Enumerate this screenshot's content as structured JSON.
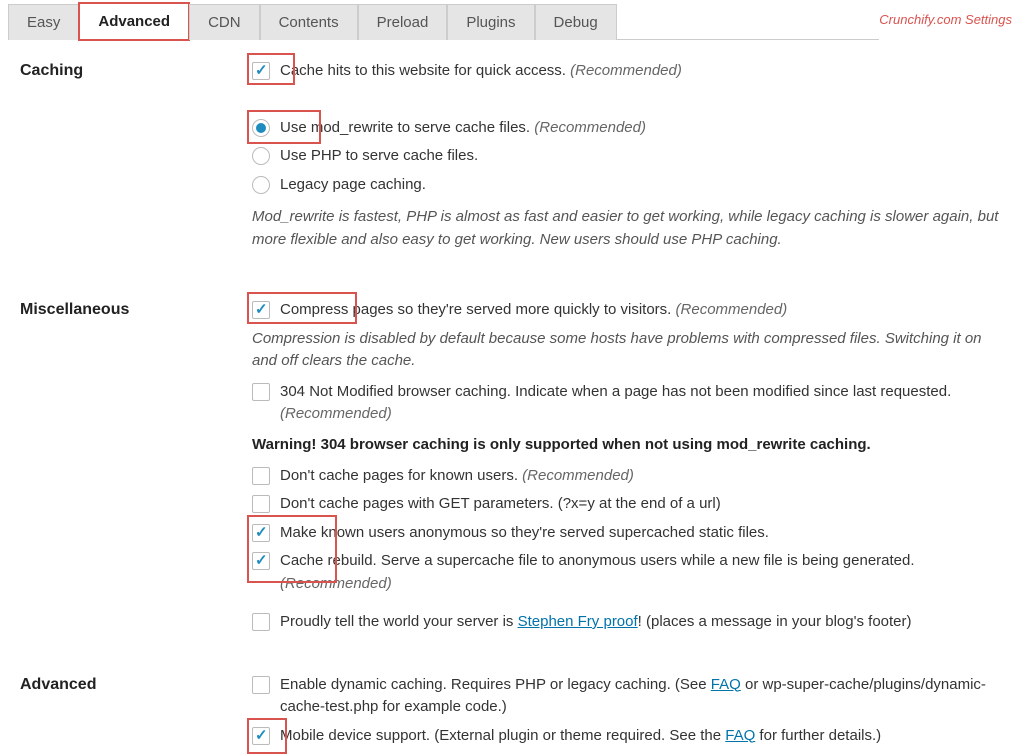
{
  "watermark": "Crunchify.com Settings",
  "tabs": [
    "Easy",
    "Advanced",
    "CDN",
    "Contents",
    "Preload",
    "Plugins",
    "Debug"
  ],
  "active_tab_index": 1,
  "sections": {
    "caching": {
      "title": "Caching",
      "cache_hits": {
        "label": "Cache hits to this website for quick access.",
        "reco": "(Recommended)",
        "checked": true
      },
      "serve": {
        "mod_rewrite": {
          "label": "Use mod_rewrite to serve cache files.",
          "reco": "(Recommended)"
        },
        "php": {
          "label": "Use PHP to serve cache files."
        },
        "legacy": {
          "label": "Legacy page caching."
        }
      },
      "desc": "Mod_rewrite is fastest, PHP is almost as fast and easier to get working, while legacy caching is slower again, but more flexible and also easy to get working. New users should use PHP caching."
    },
    "misc": {
      "title": "Miscellaneous",
      "compress": {
        "label": "Compress pages so they're served more quickly to visitors.",
        "reco": "(Recommended)",
        "checked": true
      },
      "compress_desc": "Compression is disabled by default because some hosts have problems with compressed files. Switching it on and off clears the cache.",
      "notmod": {
        "label": "304 Not Modified browser caching. Indicate when a page has not been modified since last requested.",
        "reco": "(Recommended)",
        "checked": false
      },
      "warning": "Warning! 304 browser caching is only supported when not using mod_rewrite caching.",
      "known_users": {
        "label": "Don't cache pages for known users.",
        "reco": "(Recommended)",
        "checked": false
      },
      "get_params": {
        "label": "Don't cache pages with GET parameters. (?x=y at the end of a url)",
        "checked": false
      },
      "anon": {
        "label": "Make known users anonymous so they're served supercached static files.",
        "checked": true
      },
      "rebuild": {
        "label": "Cache rebuild. Serve a supercache file to anonymous users while a new file is being generated.",
        "reco": "(Recommended)",
        "checked": true
      },
      "proud_pre": "Proudly tell the world your server is ",
      "proud_link": "Stephen Fry proof",
      "proud_post": "! (places a message in your blog's footer)"
    },
    "advanced": {
      "title": "Advanced",
      "dynamic_pre": "Enable dynamic caching. Requires PHP or legacy caching. (See ",
      "dynamic_link": "FAQ",
      "dynamic_post": " or wp-super-cache/plugins/dynamic-cache-test.php for example code.)",
      "mobile_pre": "Mobile device support. (External plugin or theme required. See the ",
      "mobile_link": "FAQ",
      "mobile_post": " for further details.)",
      "mobile_checked": true
    }
  }
}
